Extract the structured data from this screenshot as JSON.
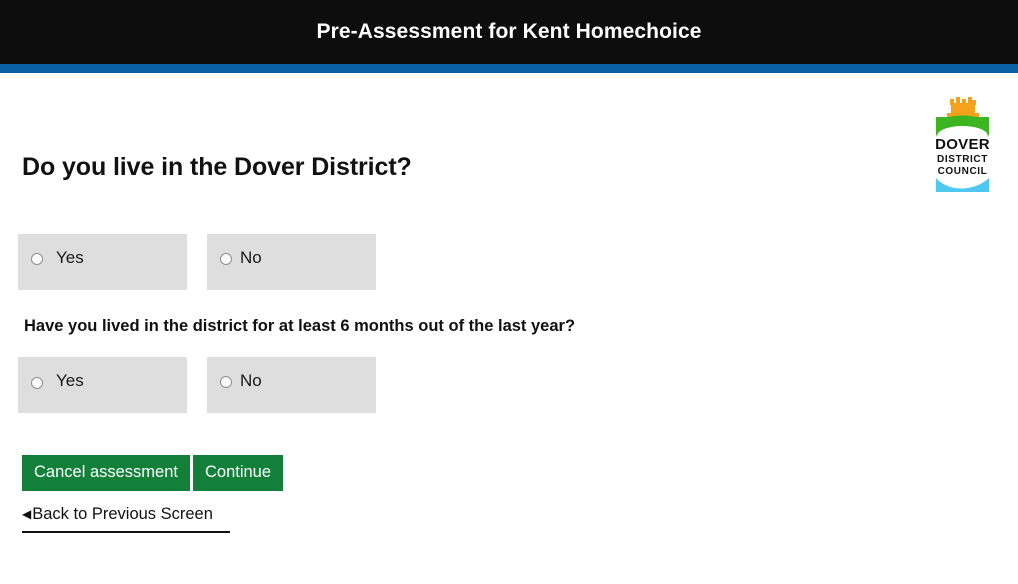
{
  "header": {
    "title": "Pre-Assessment for Kent Homechoice",
    "background_color": "#0d0d0d",
    "accent_bar_color": "#0a61a4"
  },
  "logo": {
    "name": "dover-district-council-logo",
    "line1": "DOVER",
    "line2": "DISTRICT",
    "line3": "COUNCIL",
    "crown_color": "#f5a11b",
    "hill_color": "#3cb521",
    "water_color": "#4ec8ef",
    "text_color": "#111111"
  },
  "main": {
    "questions": [
      {
        "id": "question-1",
        "text": "Do you live in the Dover District?",
        "options": [
          {
            "label": "Yes",
            "value": "yes",
            "checked": false
          },
          {
            "label": "No",
            "value": "no",
            "checked": false
          }
        ]
      },
      {
        "id": "question-2",
        "text": "Have you lived in the district for at least 6 months out of the last year?",
        "options": [
          {
            "label": "Yes",
            "value": "yes",
            "checked": false
          },
          {
            "label": "No",
            "value": "no",
            "checked": false
          }
        ]
      }
    ],
    "buttons": {
      "cancel_label": "Cancel assessment",
      "continue_label": "Continue",
      "button_color": "#13803a"
    },
    "back_link": {
      "arrow": "◀",
      "label": "Back to Previous Screen"
    }
  },
  "colors": {
    "option_background": "#dedede",
    "page_background": "#ffffff",
    "text": "#111111"
  }
}
